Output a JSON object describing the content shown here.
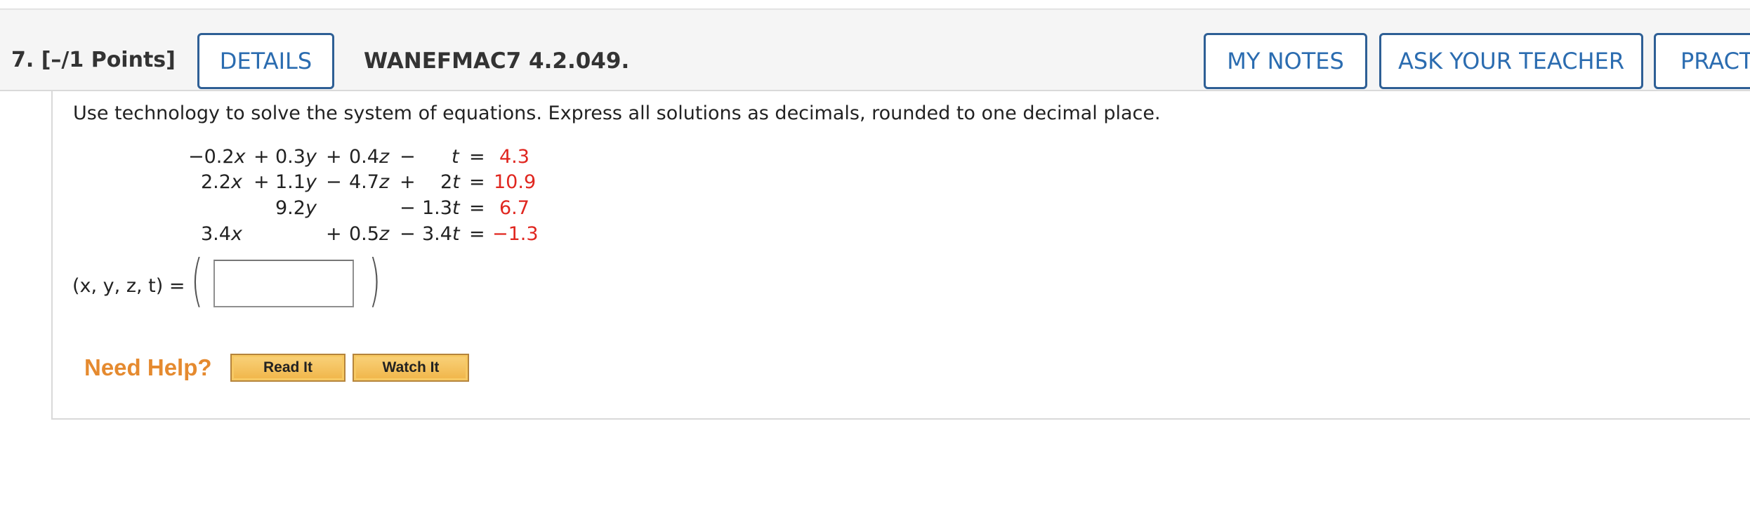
{
  "header": {
    "question_number": "7.  [–/1 Points]",
    "details_label": "DETAILS",
    "problem_id": "WANEFMAC7 4.2.049.",
    "my_notes_label": "MY NOTES",
    "ask_teacher_label": "ASK YOUR TEACHER",
    "practice_label": "PRACT"
  },
  "question": {
    "instructions": "Use technology to solve the system of equations. Express all solutions as decimals, rounded to one decimal place.",
    "equations": [
      {
        "x": "−0.2",
        "op1": "+",
        "y": "0.3",
        "op2": "+",
        "z": "0.4",
        "op3": "−",
        "t": "",
        "rhs": "4.3"
      },
      {
        "x": "2.2",
        "op1": "+",
        "y": "1.1",
        "op2": "−",
        "z": "4.7",
        "op3": "+",
        "t": "2",
        "rhs": "10.9"
      },
      {
        "x": "",
        "op1": "",
        "y": "9.2",
        "op2": "",
        "z": "",
        "op3": "−",
        "t": "1.3",
        "rhs": "6.7"
      },
      {
        "x": "3.4",
        "op1": "",
        "y": "",
        "op2": "+",
        "z": "0.5",
        "op3": "−",
        "t": "3.4",
        "rhs": "−1.3"
      }
    ],
    "answer_label": "(x, y, z, t) =",
    "answer_value": ""
  },
  "help": {
    "need_help_label": "Need Help?",
    "read_it_label": "Read It",
    "watch_it_label": "Watch It"
  },
  "colors": {
    "accent_blue": "#2b6cb0",
    "rhs_red": "#e0261f",
    "need_help_orange": "#e58a2f"
  }
}
